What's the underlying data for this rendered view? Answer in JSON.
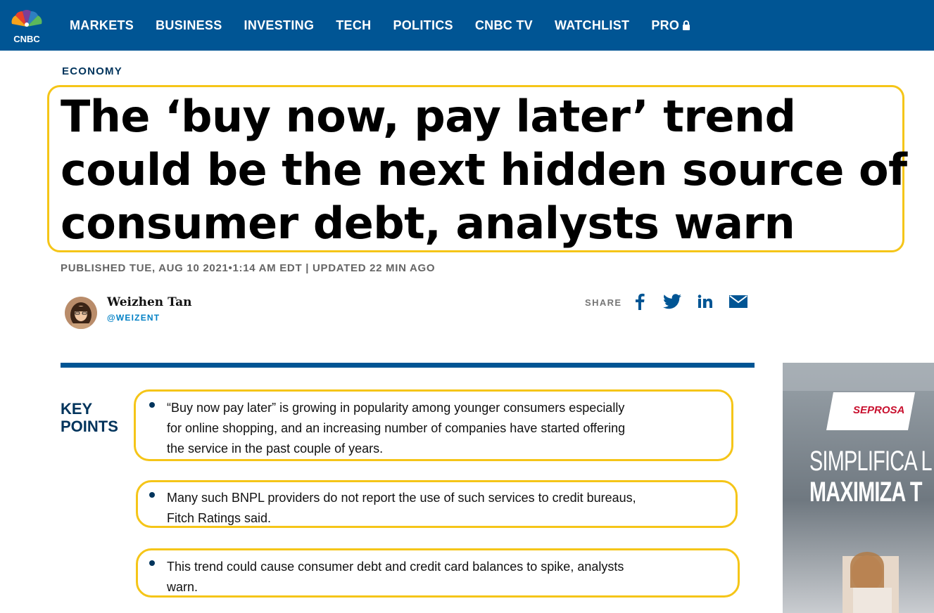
{
  "nav": {
    "logo_text": "CNBC",
    "items": [
      "MARKETS",
      "BUSINESS",
      "INVESTING",
      "TECH",
      "POLITICS",
      "CNBC TV",
      "WATCHLIST",
      "PRO"
    ]
  },
  "article": {
    "section": "ECONOMY",
    "headline": "The ‘buy now, pay later’ trend could be the next hidden source of consumer debt, analysts warn",
    "published": "PUBLISHED TUE, AUG 10 2021•1:14 AM EDT | UPDATED 22 MIN AGO",
    "author": {
      "name": "Weizhen Tan",
      "handle": "@WEIZENT"
    },
    "share": {
      "label": "SHARE",
      "icons": [
        "facebook-icon",
        "twitter-icon",
        "linkedin-icon",
        "email-icon"
      ]
    },
    "key_points": {
      "title_line1": "KEY",
      "title_line2": "POINTS",
      "items": [
        {
          "line1": "“Buy now pay later” is growing in popularity among younger consumers especially",
          "line2": "for online shopping, and an increasing number of companies have started offering",
          "line3": "the service in the past couple of years."
        },
        {
          "line1": "Many such BNPL providers do not report the use of such services to credit bureaus,",
          "line2": "Fitch Ratings said."
        },
        {
          "line1": "This trend could cause consumer debt and credit card balances to spike, analysts",
          "line2": "warn."
        }
      ]
    }
  },
  "ad": {
    "brand": "SEPROSA",
    "line1": "SIMPLIFICA L",
    "line2": "MAXIMIZA T"
  },
  "colors": {
    "nav_bg": "#005594",
    "highlight": "#f5c518",
    "key_points": "#00345c",
    "handle": "#0080c5"
  }
}
